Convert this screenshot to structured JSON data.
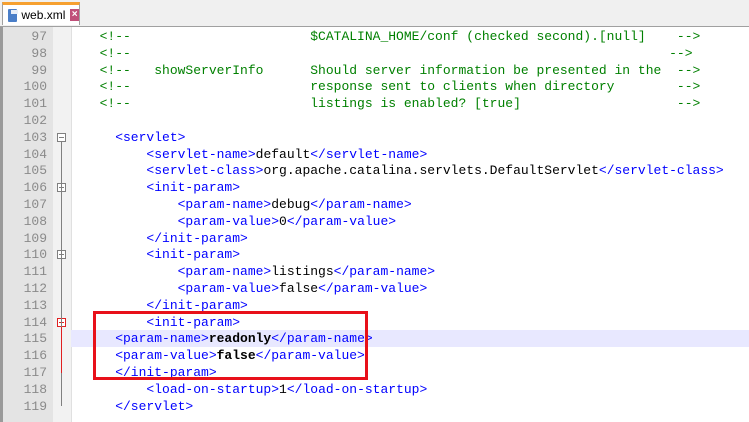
{
  "tab": {
    "title": "web.xml",
    "icon": "floppy-disk-icon",
    "close_icon": "close-icon"
  },
  "highlight_color": "#e8101a",
  "current_line": 115,
  "lines": [
    {
      "n": "97",
      "seg": [
        [
          "c",
          "  <!--                       $CATALINA_HOME/conf (checked second).[null]    -->"
        ]
      ]
    },
    {
      "n": "98",
      "seg": [
        [
          "c",
          "  <!--                                                                     -->"
        ]
      ]
    },
    {
      "n": "99",
      "seg": [
        [
          "c",
          "  <!--   showServerInfo      Should server information be presented in the  -->"
        ]
      ]
    },
    {
      "n": "100",
      "seg": [
        [
          "c",
          "  <!--                       response sent to clients when directory        -->"
        ]
      ]
    },
    {
      "n": "101",
      "seg": [
        [
          "c",
          "  <!--                       listings is enabled? [true]                    -->"
        ]
      ]
    },
    {
      "n": "102",
      "seg": []
    },
    {
      "n": "103",
      "seg": [
        [
          "t",
          "    <servlet>"
        ]
      ]
    },
    {
      "n": "104",
      "seg": [
        [
          "t",
          "        <servlet-name>"
        ],
        [
          "x",
          "default"
        ],
        [
          "t",
          "</servlet-name>"
        ]
      ]
    },
    {
      "n": "105",
      "seg": [
        [
          "t",
          "        <servlet-class>"
        ],
        [
          "x",
          "org.apache.catalina.servlets.DefaultServlet"
        ],
        [
          "t",
          "</servlet-class>"
        ]
      ]
    },
    {
      "n": "106",
      "seg": [
        [
          "t",
          "        <init-param>"
        ]
      ]
    },
    {
      "n": "107",
      "seg": [
        [
          "t",
          "            <param-name>"
        ],
        [
          "x",
          "debug"
        ],
        [
          "t",
          "</param-name>"
        ]
      ]
    },
    {
      "n": "108",
      "seg": [
        [
          "t",
          "            <param-value>"
        ],
        [
          "x",
          "0"
        ],
        [
          "t",
          "</param-value>"
        ]
      ]
    },
    {
      "n": "109",
      "seg": [
        [
          "t",
          "        </init-param>"
        ]
      ]
    },
    {
      "n": "110",
      "seg": [
        [
          "t",
          "        <init-param>"
        ]
      ]
    },
    {
      "n": "111",
      "seg": [
        [
          "t",
          "            <param-name>"
        ],
        [
          "x",
          "listings"
        ],
        [
          "t",
          "</param-name>"
        ]
      ]
    },
    {
      "n": "112",
      "seg": [
        [
          "t",
          "            <param-value>"
        ],
        [
          "x",
          "false"
        ],
        [
          "t",
          "</param-value>"
        ]
      ]
    },
    {
      "n": "113",
      "seg": [
        [
          "t",
          "        </init-param>"
        ]
      ]
    },
    {
      "n": "114",
      "seg": [
        [
          "t",
          "        <init-param>"
        ]
      ]
    },
    {
      "n": "115",
      "seg": [
        [
          "t",
          "    <param-name>"
        ],
        [
          "v",
          "readonly"
        ],
        [
          "t",
          "</param-name>"
        ]
      ]
    },
    {
      "n": "116",
      "seg": [
        [
          "t",
          "    <param-value>"
        ],
        [
          "v",
          "false"
        ],
        [
          "t",
          "</param-value>"
        ]
      ]
    },
    {
      "n": "117",
      "seg": [
        [
          "t",
          "    </init-param>"
        ]
      ]
    },
    {
      "n": "118",
      "seg": [
        [
          "t",
          "        <load-on-startup>"
        ],
        [
          "x",
          "1"
        ],
        [
          "t",
          "</load-on-startup>"
        ]
      ]
    },
    {
      "n": "119",
      "seg": [
        [
          "t",
          "    </servlet>"
        ]
      ]
    }
  ]
}
